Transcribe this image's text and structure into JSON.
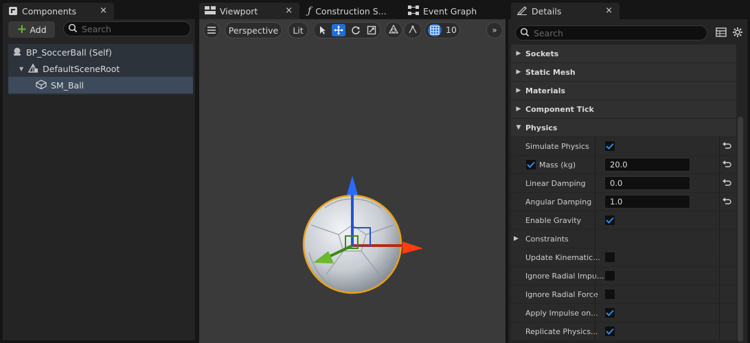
{
  "components_panel": {
    "tab_label": "Components",
    "close_glyph": "×",
    "add_label": "Add",
    "search_placeholder": "Search",
    "tree": [
      {
        "label": "BP_SoccerBall (Self)",
        "icon": "blueprint-icon"
      },
      {
        "label": "DefaultSceneRoot",
        "icon": "scene-root-icon"
      },
      {
        "label": "SM_Ball",
        "icon": "static-mesh-icon",
        "selected": true
      }
    ]
  },
  "editor_tabs": [
    {
      "label": "Viewport",
      "close_glyph": "×",
      "active": true
    },
    {
      "label": "Construction S...",
      "icon": "function-icon"
    },
    {
      "label": "Event Graph",
      "icon": "graph-icon"
    }
  ],
  "viewport_toolbar": {
    "perspective_label": "Perspective",
    "lit_label": "Lit",
    "grid_snap_value": "10"
  },
  "details_panel": {
    "tab_label": "Details",
    "close_glyph": "×",
    "search_placeholder": "Search",
    "categories": [
      {
        "label": "Sockets"
      },
      {
        "label": "Static Mesh"
      },
      {
        "label": "Materials"
      },
      {
        "label": "Component Tick"
      },
      {
        "label": "Physics",
        "expanded": true
      }
    ],
    "physics": [
      {
        "label": "Simulate Physics",
        "type": "checkbox",
        "checked": true,
        "reset": true
      },
      {
        "label": "Mass (kg)",
        "type": "number",
        "value": "20.0",
        "label_checkbox": true,
        "reset": true
      },
      {
        "label": "Linear Damping",
        "type": "number",
        "value": "0.0",
        "reset": true
      },
      {
        "label": "Angular Damping",
        "type": "number",
        "value": "1.0",
        "reset": true
      },
      {
        "label": "Enable Gravity",
        "type": "checkbox",
        "checked": true
      }
    ],
    "constraints_label": "Constraints",
    "more": [
      {
        "label": "Update Kinematic...",
        "checked": false
      },
      {
        "label": "Ignore Radial Impu...",
        "checked": false
      },
      {
        "label": "Ignore Radial Force",
        "checked": false
      },
      {
        "label": "Apply Impulse on...",
        "checked": true
      },
      {
        "label": "Replicate Physics...",
        "checked": true
      }
    ]
  },
  "colors": {
    "accent_blue": "#1f6fd6",
    "selection_orange": "#e8a21a",
    "check_blue": "#2d8cf0"
  }
}
